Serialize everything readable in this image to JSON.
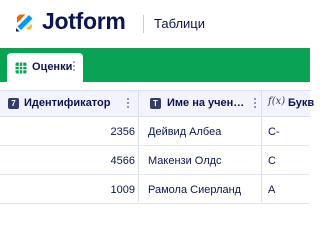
{
  "app": {
    "brand": "Jotform",
    "product": "Таблици"
  },
  "tabs": [
    {
      "label": "Оценки",
      "icon": "table-grid-icon"
    }
  ],
  "columns": [
    {
      "type_badge": "7",
      "type_icon": "number-type-icon",
      "label": "Идентификатор"
    },
    {
      "type_badge": "T",
      "type_icon": "text-type-icon",
      "label": "Име на учен…"
    },
    {
      "type_badge": "f(x)",
      "type_icon": "formula-type-icon",
      "label": "Букв"
    }
  ],
  "rows": [
    {
      "id": "2356",
      "name": "Дейвид Албеа",
      "grade": "C-"
    },
    {
      "id": "4566",
      "name": "Макензи Олдс",
      "grade": "C"
    },
    {
      "id": "1009",
      "name": "Рамола Сиерланд",
      "grade": "A"
    }
  ],
  "colors": {
    "accent": "#0aa253",
    "ink": "#0a1551",
    "header_bg": "#f3f3fe"
  }
}
